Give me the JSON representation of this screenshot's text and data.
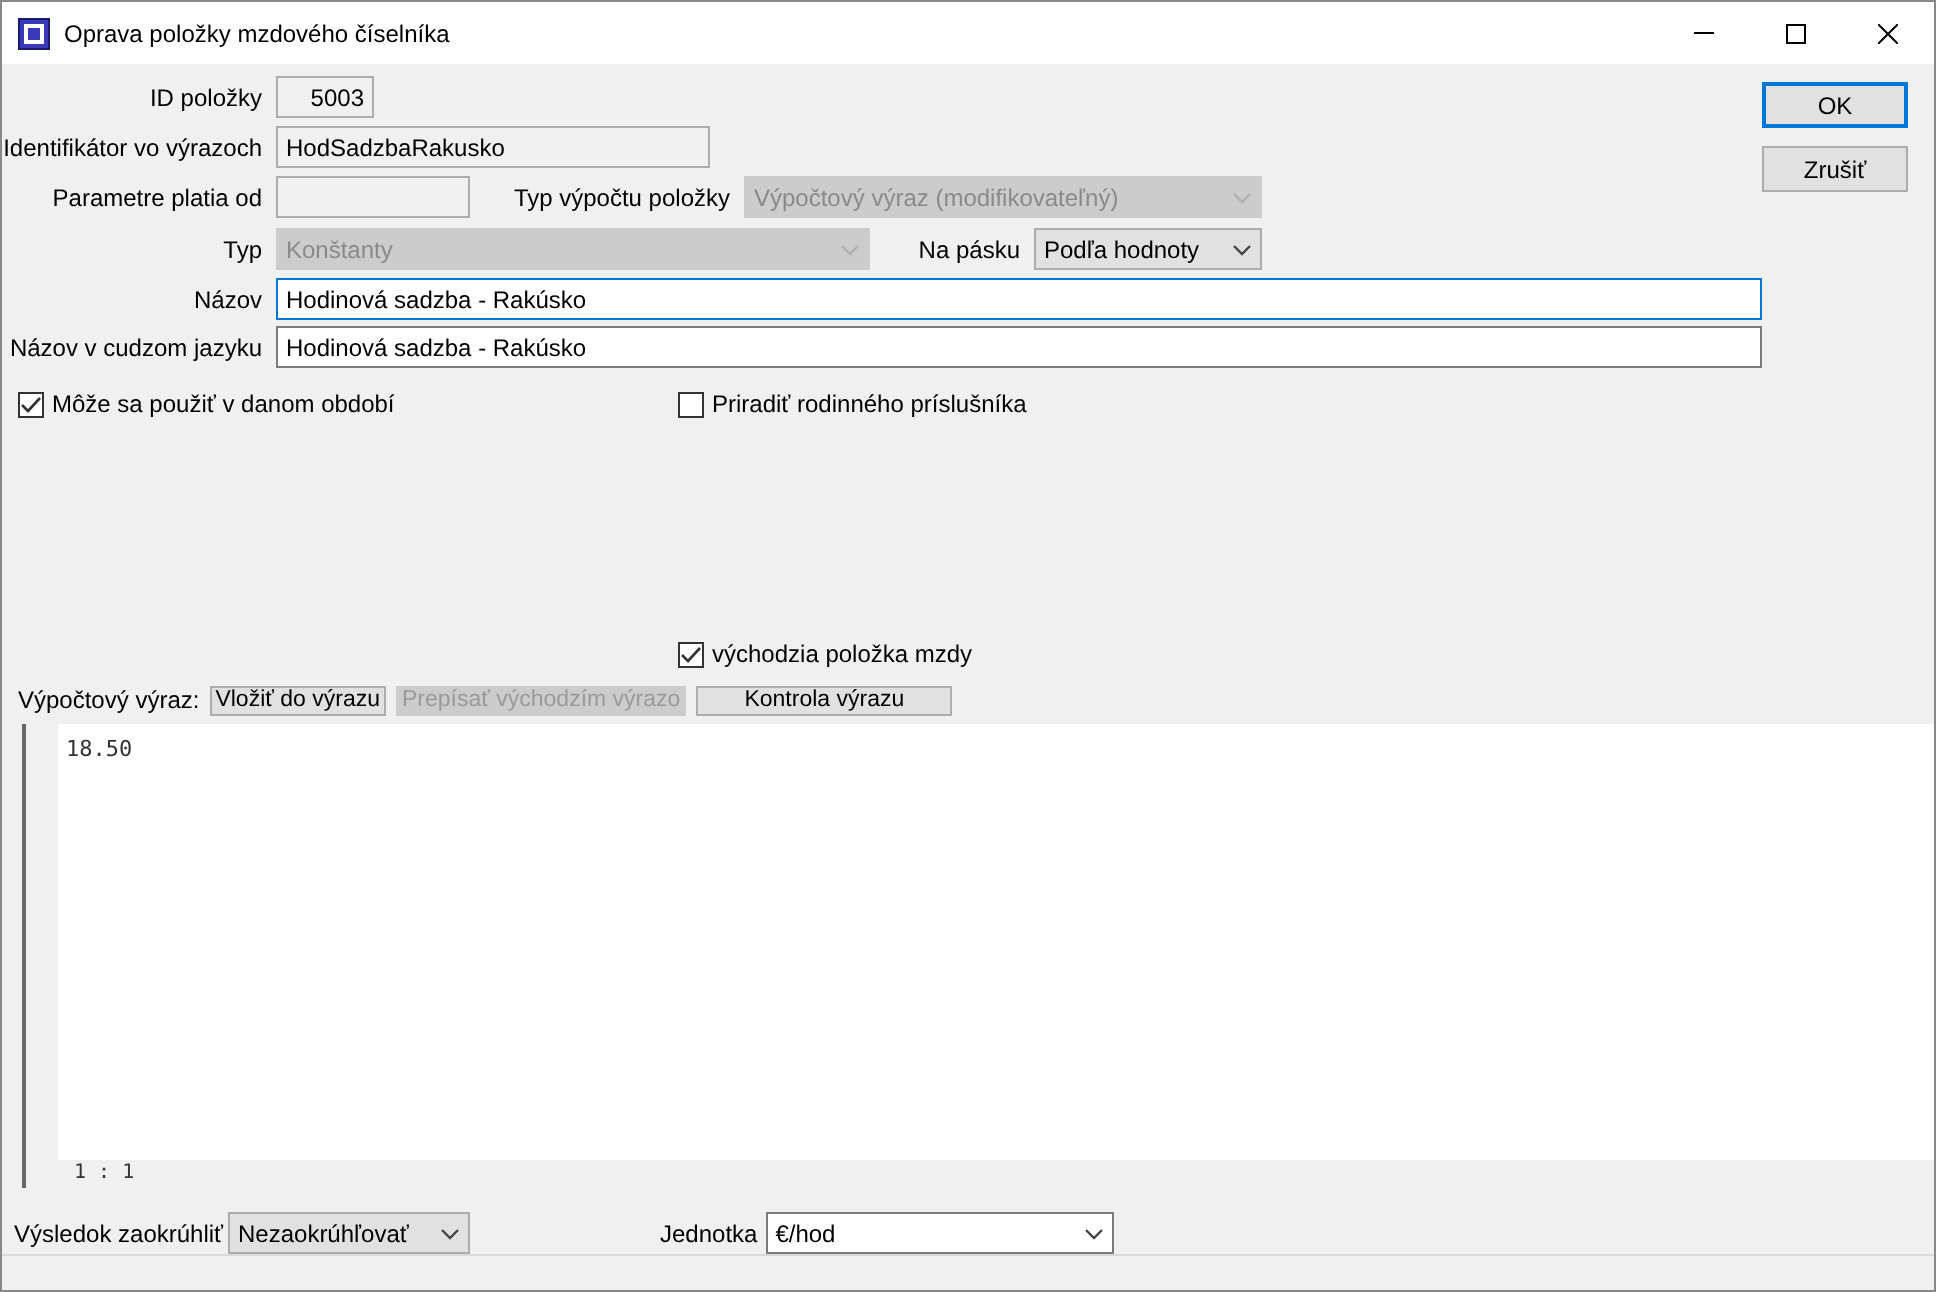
{
  "window": {
    "title": "Oprava položky mzdového číselníka"
  },
  "buttons": [
    {
      "label": "OK",
      "default": true
    },
    {
      "label": "Zrušiť",
      "default": false
    }
  ],
  "id_field": {
    "label": "ID položky",
    "value": "5003",
    "disabled": true
  },
  "identifier_field": {
    "label": "Identifikátor vo výrazoch",
    "value": "HodSadzbaRakusko",
    "disabled": true
  },
  "valid_from_field": {
    "label": "Parametre platia od",
    "disabled": true
  },
  "calc_type": {
    "label": "Typ výpočtu položky",
    "value": "Výpočtový výraz (modifikovateľný)",
    "disabled": true
  },
  "type": {
    "label": "Typ",
    "value": "Konštanty",
    "disabled": true
  },
  "on_payslip": {
    "label": "Na pásku",
    "value": "Podľa hodnoty",
    "disabled": false
  },
  "name_field": {
    "label": "Názov",
    "value": "Hodinová sadzba - Rakúsko",
    "focused": true
  },
  "foreign_name_field": {
    "label": "Názov v cudzom jazyku",
    "value": "Hodinová sadzba - Rakúsko",
    "focused": false
  },
  "usable_checkbox": {
    "label": "Môže sa použiť v danom období",
    "checked": true
  },
  "family_checkbox": {
    "label": "Priradiť rodinného príslušníka",
    "checked": false
  },
  "default_item_checkbox": {
    "label": "východzia položka mzdy",
    "checked": true
  },
  "expression": {
    "label": "Výpočtový výraz:",
    "toolbar": [
      {
        "label": "Vložiť do výrazu",
        "disabled": false
      },
      {
        "label": "Prepísať východzím výrazo",
        "disabled": true
      },
      {
        "label": "Kontrola výrazu",
        "disabled": false
      }
    ],
    "code": "18.50",
    "cursor": "1 : 1"
  },
  "rounding": {
    "label": "Výsledok zaokrúhliť",
    "value": "Nezaokrúhľovať"
  },
  "unit": {
    "label": "Jednotka",
    "value": "€/hod"
  }
}
